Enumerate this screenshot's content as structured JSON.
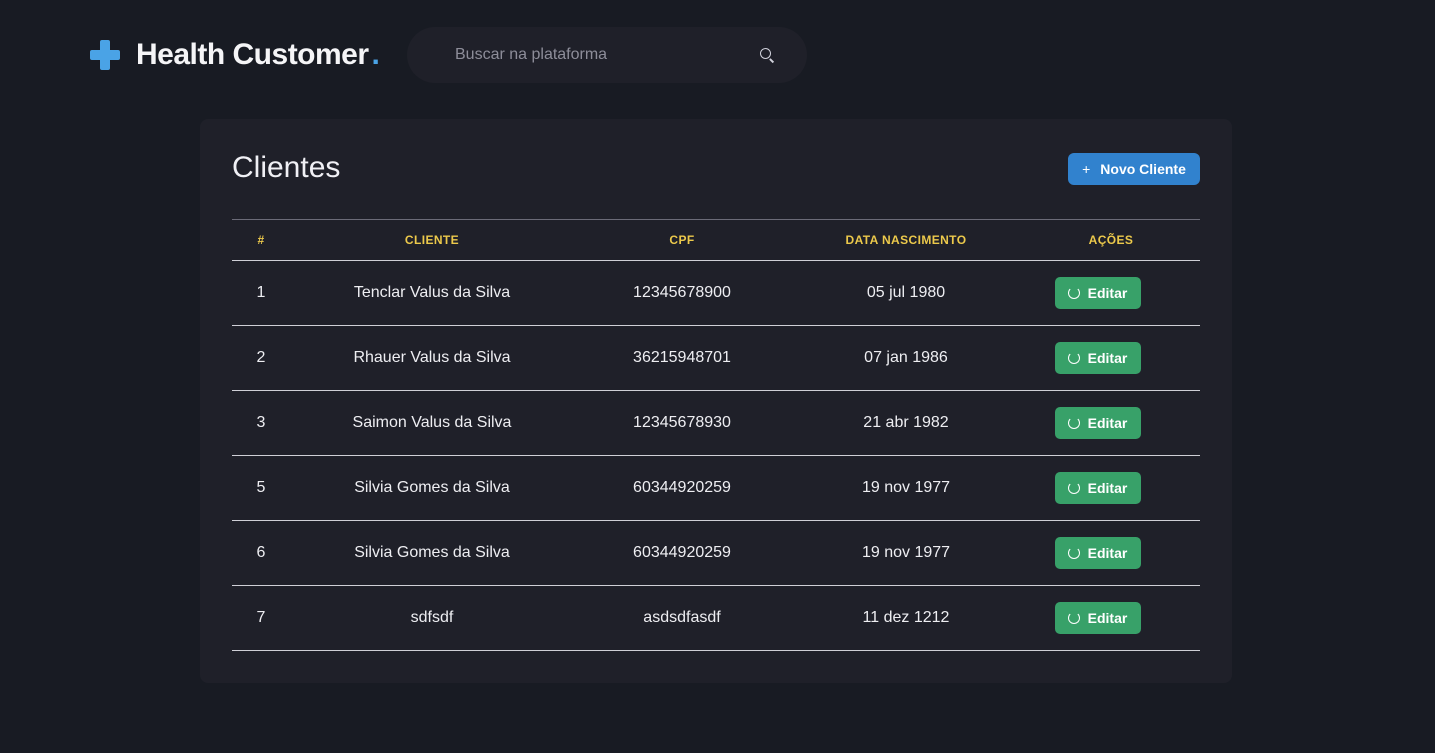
{
  "header": {
    "title": "Health Customer",
    "title_dot": ".",
    "search": {
      "placeholder": "Buscar na plataforma",
      "value": ""
    }
  },
  "colors": {
    "background": "#181b23",
    "card": "#1f2029",
    "accent": "#4aa3e6",
    "primary_button": "#3182ce",
    "edit_button": "#38a169",
    "table_header": "#ecc94b"
  },
  "main": {
    "title": "Clientes",
    "new_button_icon": "+",
    "new_button_label": "Novo Cliente",
    "table": {
      "columns": [
        "#",
        "Cliente",
        "CPF",
        "Data Nascimento",
        "Ações"
      ],
      "rows": [
        {
          "id": "1",
          "name": "Tenclar Valus da Silva",
          "cpf": "12345678900",
          "birth": "05 jul 1980",
          "action": "Editar"
        },
        {
          "id": "2",
          "name": "Rhauer Valus da Silva",
          "cpf": "36215948701",
          "birth": "07 jan 1986",
          "action": "Editar"
        },
        {
          "id": "3",
          "name": "Saimon Valus da Silva",
          "cpf": "12345678930",
          "birth": "21 abr 1982",
          "action": "Editar"
        },
        {
          "id": "5",
          "name": "Silvia Gomes da Silva",
          "cpf": "60344920259",
          "birth": "19 nov 1977",
          "action": "Editar"
        },
        {
          "id": "6",
          "name": "Silvia Gomes da Silva",
          "cpf": "60344920259",
          "birth": "19 nov 1977",
          "action": "Editar"
        },
        {
          "id": "7",
          "name": "sdfsdf",
          "cpf": "asdsdfasdf",
          "birth": "11 dez 1212",
          "action": "Editar"
        }
      ]
    }
  },
  "icons": {
    "logo": "plus-cross-icon",
    "search": "search-icon",
    "new_button": "plus-icon",
    "edit": "refresh-icon"
  }
}
